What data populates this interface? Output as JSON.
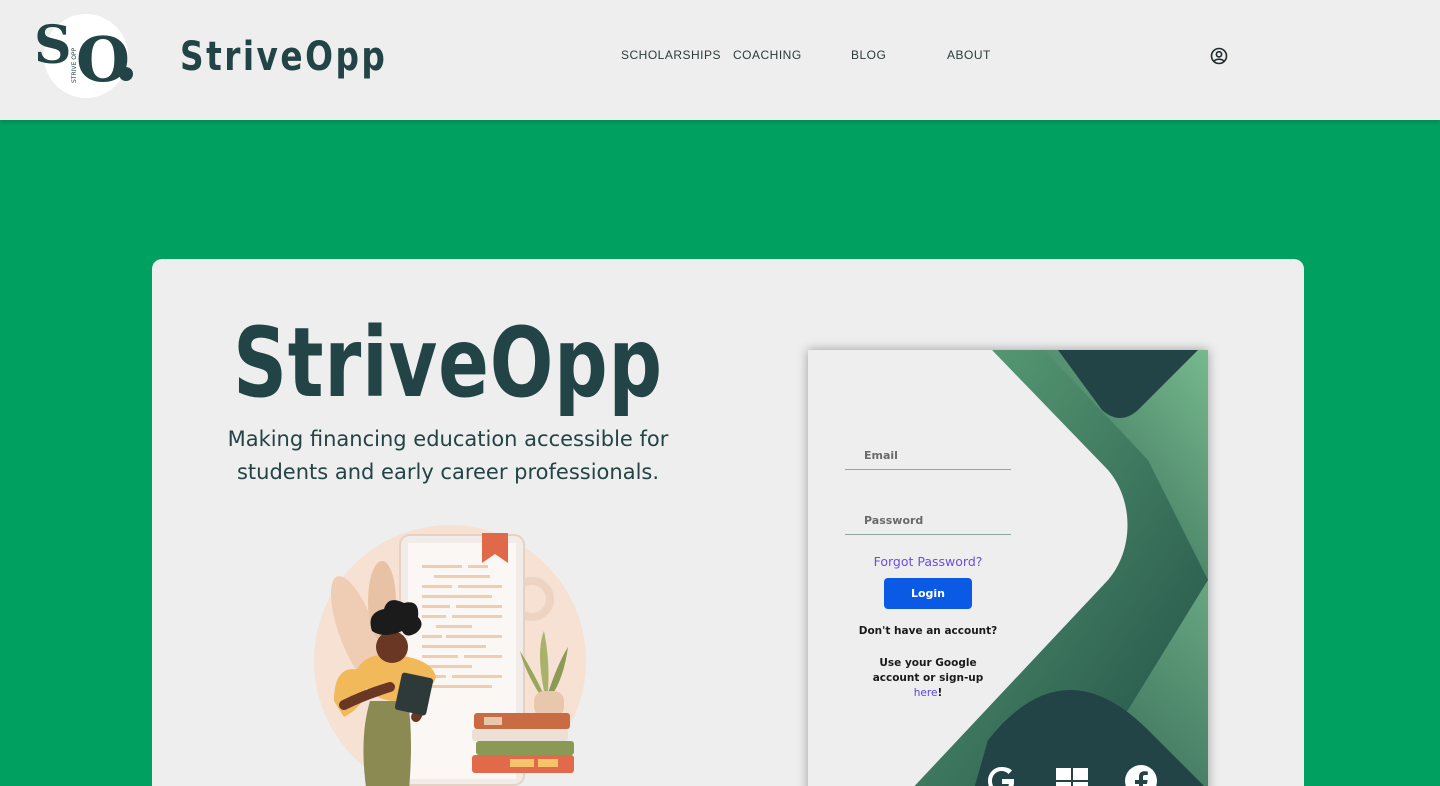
{
  "header": {
    "logo_text": "SO",
    "logo_small_text": "STRIVE OPP",
    "brand": "StriveOpp",
    "nav": [
      {
        "label": "SCHOLARSHIPS"
      },
      {
        "label": "COACHING"
      },
      {
        "label": "BLOG"
      },
      {
        "label": "ABOUT"
      }
    ],
    "user_icon": "user-circle-icon"
  },
  "hero": {
    "title": "StriveOpp",
    "subtitle_line1": "Making financing education accessible for",
    "subtitle_line2": "students and early career professionals."
  },
  "login": {
    "email_placeholder": "Email",
    "password_placeholder": "Password",
    "forgot": "Forgot Password?",
    "login_button": "Login",
    "no_account": "Don't have an account?",
    "google_note": "Use your Google account or sign-up",
    "here_link": "here",
    "exclaim": "!",
    "social": [
      "google-icon",
      "windows-icon",
      "facebook-icon"
    ]
  },
  "colors": {
    "background": "#00a061",
    "brand_dark": "#234446",
    "panel": "#eeeeee",
    "accent_blue": "#0a5ae6",
    "link_purple": "#6b4fd8"
  }
}
